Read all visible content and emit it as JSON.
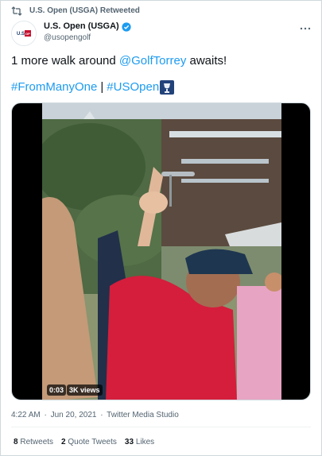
{
  "retweet": {
    "text": "U.S. Open (USGA) Retweeted",
    "icon": "retweet-icon"
  },
  "author": {
    "display_name": "U.S. Open (USGA)",
    "handle": "@usopengolf",
    "avatar_text": "U.S. OPEN",
    "verified": true,
    "verified_color": "#1d9bf0"
  },
  "tweet": {
    "text_prefix": "1 more walk around ",
    "mention": "@GolfTorrey",
    "text_suffix": " awaits!",
    "hashtag1": "#FromManyOne",
    "separator": "|",
    "hashtag2": "#USOpen"
  },
  "video": {
    "time": "0:03",
    "views": "3K views"
  },
  "meta": {
    "time": "4:22 AM",
    "dot1": "·",
    "date": "Jun 20, 2021",
    "dot2": "·",
    "source": "Twitter Media Studio"
  },
  "stats": {
    "retweets_count": "8",
    "retweets_label": "Retweets",
    "quotes_count": "2",
    "quotes_label": "Quote Tweets",
    "likes_count": "33",
    "likes_label": "Likes"
  },
  "colors": {
    "link": "#1d9bf0",
    "text": "#0f1419",
    "secondary": "#536471"
  }
}
